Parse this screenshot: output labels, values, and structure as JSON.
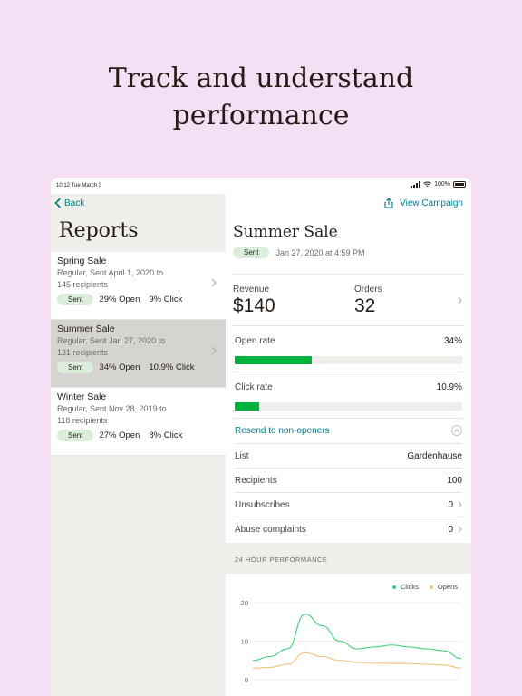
{
  "headline": {
    "line1": "Track and understand",
    "line2": "performance"
  },
  "status_bar": {
    "time": "10:12  Tue March 3",
    "battery": "100%"
  },
  "nav": {
    "back_label": "Back",
    "view_campaign_label": "View Campaign"
  },
  "reports": {
    "title": "Reports",
    "items": [
      {
        "name": "Spring Sale",
        "meta1": "Regular, Sent April 1, 2020 to",
        "meta2": "145 recipients",
        "badge": "Sent",
        "open_value": "29%",
        "open_label": "Open",
        "click_value": "9%",
        "click_label": "Click"
      },
      {
        "name": "Summer Sale",
        "meta1": "Regular, Sent Jan 27, 2020 to",
        "meta2": "131 recipients",
        "badge": "Sent",
        "open_value": "34%",
        "open_label": "Open",
        "click_value": "10.9%",
        "click_label": "Click"
      },
      {
        "name": "Winter Sale",
        "meta1": "Regular, Sent Nov 28, 2019 to",
        "meta2": "118 recipients",
        "badge": "Sent",
        "open_value": "27%",
        "open_label": "Open",
        "click_value": "8%",
        "click_label": "Click"
      }
    ]
  },
  "campaign": {
    "title": "Summer Sale",
    "badge": "Sent",
    "sent_date": "Jan 27, 2020 at 4:59 PM",
    "revenue_label": "Revenue",
    "revenue_value": "$140",
    "orders_label": "Orders",
    "orders_value": "32",
    "open_rate_label": "Open rate",
    "open_rate_value": "34%",
    "open_rate_fraction": 0.34,
    "click_rate_label": "Click rate",
    "click_rate_value": "10.9%",
    "click_rate_fraction": 0.109,
    "resend_label": "Resend to non-openers",
    "details": [
      {
        "key": "List",
        "value": "Gardenhause"
      },
      {
        "key": "Recipients",
        "value": "100"
      },
      {
        "key": "Unsubscribes",
        "value": "0"
      },
      {
        "key": "Abuse complaints",
        "value": "0"
      }
    ]
  },
  "performance": {
    "title": "24 HOUR PERFORMANCE",
    "legend_clicks": "Clicks",
    "legend_opens": "Opens"
  },
  "colors": {
    "background": "#f4dff4",
    "accent_link": "#007c89",
    "bar_green": "#00b140",
    "badge_bg": "#dbeedb",
    "clicks_line": "#3ecf73",
    "opens_line": "#f0c27a"
  },
  "chart_data": {
    "type": "line",
    "title": "24 HOUR PERFORMANCE",
    "xlabel": "",
    "ylabel": "",
    "ylim": [
      0,
      20
    ],
    "y_ticks": [
      "0",
      "10",
      "20"
    ],
    "x": [
      0,
      2,
      4,
      6,
      8,
      10,
      12,
      14,
      16,
      18,
      20,
      22,
      24
    ],
    "series": [
      {
        "name": "Clicks",
        "values": [
          5,
          6,
          8,
          17,
          14,
          10,
          8,
          8.5,
          9,
          8.5,
          8,
          7.5,
          5.5
        ]
      },
      {
        "name": "Opens",
        "values": [
          3,
          3.2,
          4,
          7,
          6,
          5,
          4.5,
          4.3,
          4.2,
          4.2,
          4,
          3.8,
          3
        ]
      }
    ],
    "grid": true,
    "legend_position": "top-right"
  }
}
